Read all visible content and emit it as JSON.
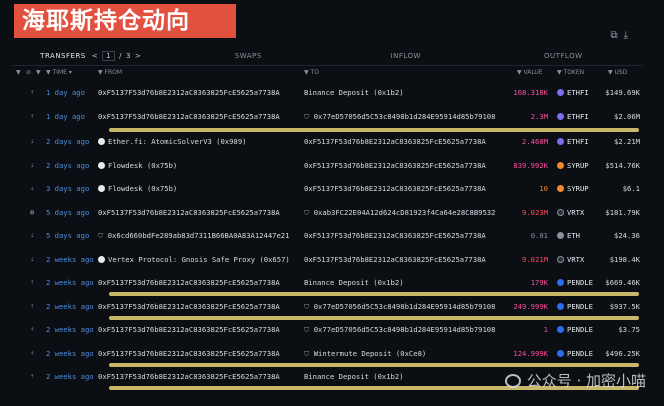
{
  "banner": {
    "text": "海耶斯持仓动向"
  },
  "tabs": [
    {
      "label": "TRANSFERS",
      "active": true
    },
    {
      "label": "SWAPS",
      "active": false
    },
    {
      "label": "INFLOW",
      "active": false
    },
    {
      "label": "OUTFLOW",
      "active": false
    }
  ],
  "pager": {
    "current": "1",
    "sep": "/",
    "total": "3",
    "prev": "<",
    "next": ">"
  },
  "columns": {
    "time": "TIME",
    "from": "FROM",
    "to": "TO",
    "value": "VALUE",
    "token": "TOKEN",
    "usd": "USD"
  },
  "colors": {
    "pink": "#ff4fa0",
    "red": "#ff4d5a",
    "orange": "#f08a2c",
    "highlight": "#c9b86a",
    "link": "#4c8fe0"
  },
  "rows": [
    {
      "time": "1 day ago",
      "from": "0xF5137F53d76b8E2312aC8363825FcE5625a7738A",
      "to": "Binance Deposit (0x1b2)",
      "value": "168.318K",
      "value_color": "#ff4fa0",
      "token": "ETHFI",
      "usd": "$149.69K",
      "underline": false
    },
    {
      "time": "1 day ago",
      "from": "0xF5137F53d76b8E2312aC8363825FcE5625a7738A",
      "to": "0x77eD57056d5C53c8498b1d284E95914d85b79108",
      "value": "2.3M",
      "value_color": "#ff4fa0",
      "token": "ETHFI",
      "usd": "$2.06M",
      "underline": true
    },
    {
      "time": "2 days ago",
      "from": "Ether.fi: AtomicSolverV3 (0x989)",
      "to": "0xF5137F53d76b8E2312aC8363825FcE5625a7738A",
      "value": "2.468M",
      "value_color": "#ff4fa0",
      "token": "ETHFI",
      "usd": "$2.21M",
      "underline": false
    },
    {
      "time": "2 days ago",
      "from": "Flowdesk (0x75b)",
      "to": "0xF5137F53d76b8E2312aC8363825FcE5625a7738A",
      "value": "839.992K",
      "value_color": "#ff4fa0",
      "token": "SYRUP",
      "usd": "$514.76K",
      "underline": false
    },
    {
      "time": "3 days ago",
      "from": "Flowdesk (0x75b)",
      "to": "0xF5137F53d76b8E2312aC8363825FcE5625a7738A",
      "value": "10",
      "value_color": "#f08a2c",
      "token": "SYRUP",
      "usd": "$6.1",
      "underline": false
    },
    {
      "time": "5 days ago",
      "from": "0xF5137F53d76b8E2312aC8363825FcE5625a7738A",
      "to": "0xab3FC22E04A12d624cD81923f4Ca64e28C8B9532",
      "value": "9.023M",
      "value_color": "#ff4d5a",
      "token": "VRTX",
      "usd": "$181.79K",
      "underline": false
    },
    {
      "time": "5 days ago",
      "from": "0x6cd660bdFe289ab83d7311B66BA0A83A12447e21",
      "to": "0xF5137F53d76b8E2312aC8363825FcE5625a7738A",
      "value": "0.01",
      "value_color": "#8a919b",
      "token": "ETH",
      "usd": "$24.36",
      "underline": false
    },
    {
      "time": "2 weeks ago",
      "from": "Vertex Protocol: Gnosis Safe Proxy (0x657)",
      "to": "0xF5137F53d76b8E2312aC8363825FcE5625a7738A",
      "value": "9.021M",
      "value_color": "#ff4d5a",
      "token": "VRTX",
      "usd": "$198.4K",
      "underline": false
    },
    {
      "time": "2 weeks ago",
      "from": "0xF5137F53d76b8E2312aC8363825FcE5625a7738A",
      "to": "Binance Deposit (0x1b2)",
      "value": "179K",
      "value_color": "#ff4fa0",
      "token": "PENDLE",
      "usd": "$669.46K",
      "underline": true
    },
    {
      "time": "2 weeks ago",
      "from": "0xF5137F53d76b8E2312aC8363825FcE5625a7738A",
      "to": "0x77eD57056d5C53c8498b1d284E95914d85b79108",
      "value": "249.999K",
      "value_color": "#ff4fa0",
      "token": "PENDLE",
      "usd": "$937.5K",
      "underline": true
    },
    {
      "time": "2 weeks ago",
      "from": "0xF5137F53d76b8E2312aC8363825FcE5625a7738A",
      "to": "0x77eD57056d5C53c8498b1d284E95914d85b79108",
      "value": "1",
      "value_color": "#ff4fa0",
      "token": "PENDLE",
      "usd": "$3.75",
      "underline": false
    },
    {
      "time": "2 weeks ago",
      "from": "0xF5137F53d76b8E2312aC8363825FcE5625a7738A",
      "to": "Wintermute Deposit (0xCe8)",
      "value": "124.999K",
      "value_color": "#ff4fa0",
      "token": "PENDLE",
      "usd": "$496.25K",
      "underline": true
    },
    {
      "time": "2 weeks ago",
      "from": "0xF5137F53d76b8E2312aC8363825FcE5625a7738A",
      "to": "Binance Deposit (0x1b2)",
      "value": "",
      "value_color": "#ff4fa0",
      "token": "",
      "usd": "",
      "underline": false
    }
  ],
  "watermark": {
    "text": "公众号 · 加密小喵"
  }
}
